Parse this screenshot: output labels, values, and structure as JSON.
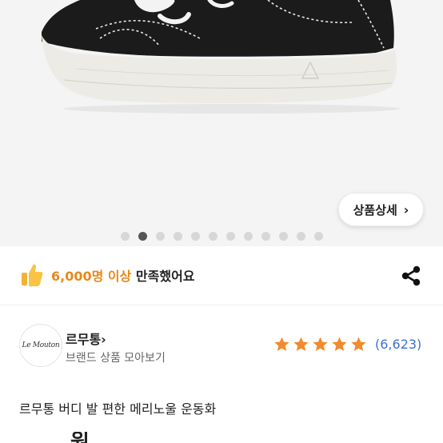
{
  "gallery": {
    "detail_button_label": "상품상세",
    "detail_button_icon": "chevron-right-icon",
    "dot_count": 12,
    "active_index": 1
  },
  "satisfaction": {
    "icon": "thumbs-up-icon",
    "count_text": "6,000명 이상",
    "suffix_text": " 만족했어요",
    "highlight_color": "#e8881c"
  },
  "share": {
    "icon": "share-icon"
  },
  "brand": {
    "logo_text": "Le Mouton",
    "name": "르무통",
    "name_chevron": "›",
    "link_label": "브랜드 상품 모아보기"
  },
  "rating": {
    "stars": 5,
    "max_stars": 5,
    "star_color": "#f28a2e",
    "review_count": "(6,623)"
  },
  "product": {
    "title": "르무통 버디 발 편한 메리노울 운동화",
    "price_partial": "원"
  }
}
